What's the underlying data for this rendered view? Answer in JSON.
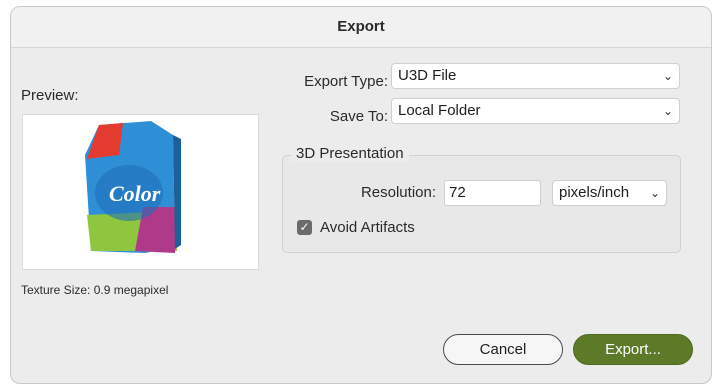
{
  "dialog": {
    "title": "Export"
  },
  "preview": {
    "label": "Preview:",
    "texture_size": "Texture Size: 0.9 megapixel",
    "product_text": "Color"
  },
  "export_type": {
    "label": "Export Type:",
    "value": "U3D File"
  },
  "save_to": {
    "label": "Save To:",
    "value": "Local Folder"
  },
  "presentation": {
    "group_title": "3D Presentation",
    "resolution_label": "Resolution:",
    "resolution_value": "72",
    "unit_value": "pixels/inch",
    "avoid_artifacts_label": "Avoid Artifacts",
    "avoid_artifacts_checked": true
  },
  "buttons": {
    "cancel": "Cancel",
    "export": "Export..."
  },
  "icons": {
    "dropdown": "chevron-down-icon",
    "checkbox": "checkmark-icon"
  },
  "colors": {
    "accent": "#5d7a29",
    "checkbox": "#6b6b6b"
  }
}
